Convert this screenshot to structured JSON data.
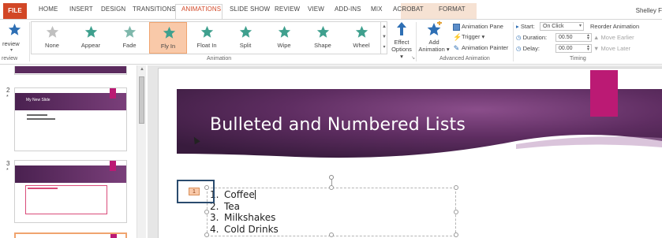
{
  "tabs": {
    "file": "FILE",
    "home": "HOME",
    "insert": "INSERT",
    "design": "DESIGN",
    "transitions": "TRANSITIONS",
    "animations": "ANIMATIONS",
    "slide_show": "SLIDE SHOW",
    "review": "REVIEW",
    "view": "VIEW",
    "add_ins": "ADD-INS",
    "mix": "MIX",
    "acrobat": "ACROBAT",
    "format": "FORMAT"
  },
  "user": "Shelley F",
  "ribbon": {
    "preview": {
      "label": "review"
    },
    "preview_group": "review",
    "animations": [
      {
        "label": "None",
        "icon": "star-none-icon"
      },
      {
        "label": "Appear",
        "icon": "star-appear-icon"
      },
      {
        "label": "Fade",
        "icon": "star-fade-icon"
      },
      {
        "label": "Fly In",
        "icon": "star-fly-in-icon"
      },
      {
        "label": "Float In",
        "icon": "star-float-in-icon"
      },
      {
        "label": "Split",
        "icon": "star-split-icon"
      },
      {
        "label": "Wipe",
        "icon": "star-wipe-icon"
      },
      {
        "label": "Shape",
        "icon": "star-shape-icon"
      },
      {
        "label": "Wheel",
        "icon": "star-wheel-icon"
      }
    ],
    "selected_animation": "Fly In",
    "animation_group": "Animation",
    "effect_options": {
      "line1": "Effect",
      "line2": "Options ▾"
    },
    "add_animation": {
      "line1": "Add",
      "line2": "Animation ▾"
    },
    "animation_pane": "Animation Pane",
    "trigger": "Trigger ▾",
    "animation_painter": "Animation Painter",
    "advanced_group": "Advanced Animation",
    "start_label": "Start:",
    "start_value": "On Click",
    "duration_label": "Duration:",
    "duration_value": "00.50",
    "delay_label": "Delay:",
    "delay_value": "00.00",
    "timing_group": "Timing",
    "reorder_title": "Reorder Animation",
    "move_earlier": "Move Earlier",
    "move_later": "Move Later"
  },
  "thumbnails": {
    "slide2_title": "My New Slide",
    "numbers": [
      "2",
      "3"
    ],
    "star": "*"
  },
  "slide": {
    "title": "Bulleted and Numbered Lists",
    "animation_tag": "1",
    "list": [
      {
        "num": "1.",
        "text": "Coffee"
      },
      {
        "num": "2.",
        "text": "Tea"
      },
      {
        "num": "3.",
        "text": "Milkshakes"
      },
      {
        "num": "4.",
        "text": "Cold Drinks"
      }
    ]
  },
  "colors": {
    "accent": "#d24726",
    "selected_fill": "#f9c9a9",
    "slide_band": "#5b2b5e",
    "slide_accent": "#bb1a74"
  }
}
